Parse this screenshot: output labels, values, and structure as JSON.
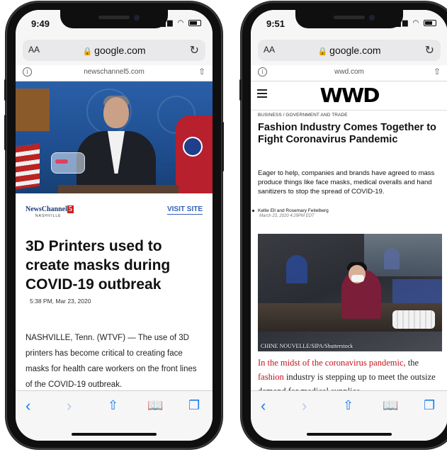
{
  "left_phone": {
    "status": {
      "time": "9:49"
    },
    "address_bar": {
      "aa": "AA",
      "domain": "google.com"
    },
    "sub_bar": {
      "site": "newschannel5.com"
    },
    "source": {
      "logo_text": "NewsChannel",
      "logo_num": "5",
      "logo_sub": "NASHVILLE",
      "visit_label": "VISIT SITE"
    },
    "article": {
      "headline": "3D Printers used to create masks during COVID-19 outbreak",
      "timestamp": "5:38 PM, Mar 23, 2020",
      "body": "NASHVILLE, Tenn. (WTVF) — The use of 3D printers has become critical to creating face masks for health care workers on the front lines of the COVID-19 outbreak."
    },
    "toolbar": [
      "back-icon",
      "forward-icon",
      "share-icon",
      "bookmarks-icon",
      "tabs-icon"
    ]
  },
  "right_phone": {
    "status": {
      "time": "9:51"
    },
    "address_bar": {
      "aa": "AA",
      "domain": "google.com"
    },
    "sub_bar": {
      "site": "wwd.com"
    },
    "header": {
      "logo": "WWD"
    },
    "article": {
      "kicker": "BUSINESS / GOVERNMENT AND TRADE",
      "headline": "Fashion Industry Comes Together to Fight Coronavirus Pandemic",
      "dek": "Eager to help, companies and brands have agreed to mass produce things like face masks, medical overalls and hand sanitizers to stop the spread of COVID-19.",
      "byline": "Kellie Ell and Rosemary Feitelberg",
      "date": "March 23, 2020 4:29PM EDT",
      "photo_credit": "CHINE NOUVELLE/SIPA/Shutterstock",
      "body_link1": "In the midst of the coronavirus pandemic,",
      "body_the": " the",
      "body_link2": "fashion",
      "body_rest": " industry is stepping up to meet the outsize demand for medical supplies,"
    },
    "toolbar": [
      "back-icon",
      "forward-icon",
      "share-icon",
      "bookmarks-icon",
      "tabs-icon"
    ]
  },
  "colors": {
    "safari_blue": "#1a7cf0",
    "wwd_link_red": "#c4121b",
    "news5_red": "#c8201f"
  }
}
